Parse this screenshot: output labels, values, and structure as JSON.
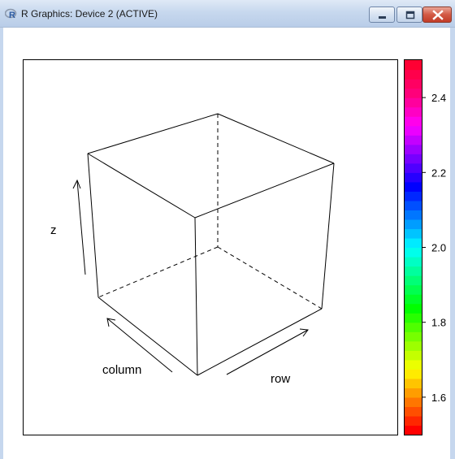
{
  "window": {
    "title": "R Graphics: Device 2 (ACTIVE)",
    "app_icon": "r-logo-icon",
    "buttons": [
      {
        "name": "minimize-button",
        "icon": "minimize-icon"
      },
      {
        "name": "maximize-button",
        "icon": "maximize-icon"
      },
      {
        "name": "close-button",
        "icon": "close-icon"
      }
    ]
  },
  "plot": {
    "axis_labels": {
      "z": "z",
      "column": "column",
      "row": "row"
    },
    "colorbar": {
      "palette": "rainbow",
      "colors_bottom_to_top": [
        "#ff0000",
        "#ff8000",
        "#ffff00",
        "#80ff00",
        "#00ff00",
        "#00ff80",
        "#00ffff",
        "#0080ff",
        "#0000ff",
        "#8000ff",
        "#ff00ff",
        "#ff0080",
        "#ff0033"
      ],
      "ticks": [
        {
          "value": 1.6,
          "label": "1.6"
        },
        {
          "value": 1.8,
          "label": "1.8"
        },
        {
          "value": 2.0,
          "label": "2.0"
        },
        {
          "value": 2.2,
          "label": "2.2"
        },
        {
          "value": 2.4,
          "label": "2.4"
        }
      ],
      "range": [
        1.5,
        2.5
      ]
    }
  }
}
